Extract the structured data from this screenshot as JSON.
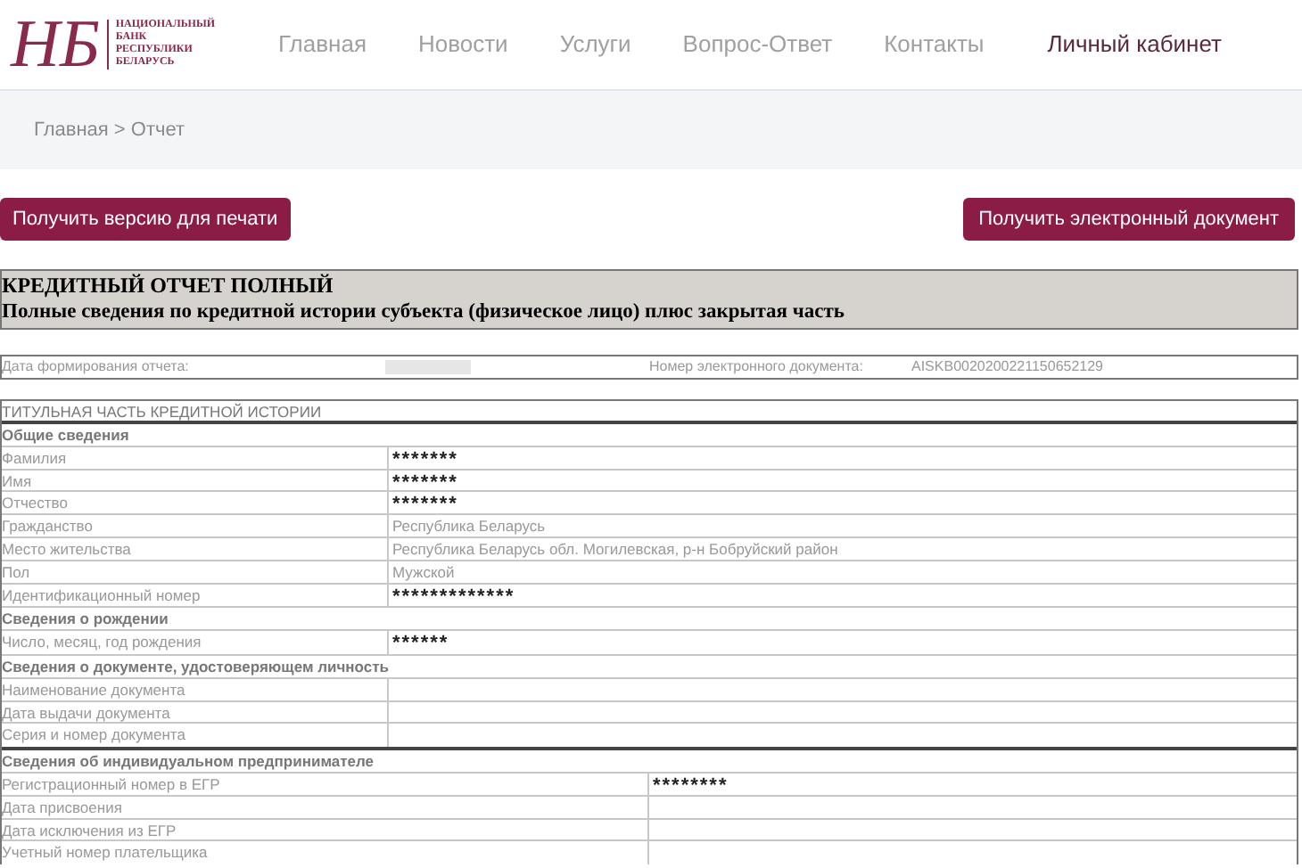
{
  "logo": {
    "monogram": "НБ",
    "lines": [
      "НАЦИОНАЛЬНЫЙ",
      "БАНК",
      "РЕСПУБЛИКИ",
      "БЕЛАРУСЬ"
    ]
  },
  "nav": [
    {
      "label": "Главная",
      "kind": "main"
    },
    {
      "label": "Новости",
      "kind": "main"
    },
    {
      "label": "Услуги",
      "kind": "main"
    },
    {
      "label": "Вопрос-Ответ",
      "kind": "main"
    },
    {
      "label": "Контакты",
      "kind": "main"
    },
    {
      "label": "Личный кабинет",
      "kind": "account"
    }
  ],
  "breadcrumb": "Главная > Отчет",
  "buttons": [
    "Получить версию для печати",
    "Получить электронный документ"
  ],
  "report": {
    "title": "КРЕДИТНЫЙ ОТЧЕТ ПОЛНЫЙ",
    "subtitle": "Полные сведения по кредитной истории субъекта (физическое лицо) плюс закрытая часть"
  },
  "info": {
    "date_label": "Дата формирования отчета:",
    "date_hidden": true,
    "number_label": "Номер электронного документа:",
    "number_value": "AISKB0020200221150652129"
  },
  "table": {
    "title": "ТИТУЛЬНАЯ ЧАСТЬ КРЕДИТНОЙ ИСТОРИИ",
    "sections": [
      {
        "title": "Общие сведения",
        "kind": "standard",
        "rows": [
          {
            "label": "Фамилия",
            "value": "*******",
            "masked": true
          },
          {
            "label": "Имя",
            "value": "*******",
            "masked": true
          },
          {
            "label": "Отчество",
            "value": "*******",
            "masked": true
          },
          {
            "label": "Гражданство",
            "value": "Республика Беларусь",
            "masked": false
          },
          {
            "label": "Место жительства",
            "value": "Республика Беларусь обл. Могилевская, р-н Бобруйский район",
            "masked": false
          },
          {
            "label": "Пол",
            "value": "Мужской",
            "masked": false
          },
          {
            "label": "Идентификационный номер",
            "value": "*************",
            "masked": true
          }
        ]
      },
      {
        "title": "Сведения о рождении",
        "kind": "standard",
        "rows": [
          {
            "label": "Число, месяц, год рождения",
            "value": "******",
            "masked": true
          }
        ]
      },
      {
        "title": "Сведения о документе, удостоверяющем личность",
        "kind": "standard",
        "rows": [
          {
            "label": "Наименование документа"
          },
          {
            "label": "Дата выдачи документа"
          },
          {
            "label": "Серия и номер документа"
          }
        ]
      },
      {
        "title": "Сведения об индивидуальном предпринимателе",
        "kind": "wide",
        "rows": [
          {
            "label": "Регистрационный номер в ЕГР",
            "value": "********",
            "masked": true
          },
          {
            "label": "Дата присвоения"
          },
          {
            "label": "Дата исключения из ЕГР"
          },
          {
            "label": "Учетный номер плательщика"
          }
        ]
      }
    ]
  }
}
